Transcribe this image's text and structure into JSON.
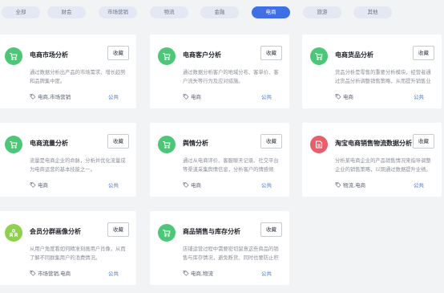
{
  "filters": [
    {
      "label": "全部",
      "active": false
    },
    {
      "label": "财会",
      "active": false
    },
    {
      "label": "市场营销",
      "active": false
    },
    {
      "label": "物流",
      "active": false
    },
    {
      "label": "金融",
      "active": false
    },
    {
      "label": "电商",
      "active": true
    },
    {
      "label": "旅游",
      "active": false
    },
    {
      "label": "其他",
      "active": false
    }
  ],
  "cards": [
    {
      "title": "电商市场分析",
      "fav_label": "收藏",
      "description": "通过数据分析出产品的市场需求、增长趋势和品牌集中度。",
      "tags": "电商,市场营销",
      "scope": "公共",
      "icon": "cart-icon",
      "icon_color": "#4cc777"
    },
    {
      "title": "电商客户分析",
      "fav_label": "收藏",
      "description": "通过数据分析客户的地域分布、客单价、客户流失等行为及应对措施。",
      "tags": "电商",
      "scope": "公共",
      "icon": "cart-icon",
      "icon_color": "#4cc777"
    },
    {
      "title": "电商货品分析",
      "fav_label": "收藏",
      "description": "货品分析是零售的重要分析模块，经营者通过货品分析调整销售策略，从而提升销售业绩。",
      "tags": "电商",
      "scope": "公共",
      "icon": "cart-icon",
      "icon_color": "#4cc777"
    },
    {
      "title": "电商流量分析",
      "fav_label": "收藏",
      "description": "流量是电商企业的命脉，分析并优化流量成为电商运营的基本技能之一。",
      "tags": "电商",
      "scope": "公共",
      "icon": "cart-icon",
      "icon_color": "#4cc777"
    },
    {
      "title": "舆情分析",
      "fav_label": "收藏",
      "description": "通过从电商评价、客服聊天记录、社交平台等渠道采集舆情信息，分析客户的情感倾向。",
      "tags": "电商",
      "scope": "公共",
      "icon": "cart-icon",
      "icon_color": "#4cc777"
    },
    {
      "title": "淘宝电商销售物流数据分析",
      "fav_label": "收藏",
      "description": "分析某电商企业的产品销售情况来指导调整企业的销售策略，以期通过数据提升业绩。",
      "tags": "物流,电商",
      "scope": "公共",
      "icon": "box-icon",
      "icon_color": "#e5606a"
    },
    {
      "title": "会员分群画像分析",
      "fav_label": "收藏",
      "description": "从用户角度看如何精准刻画用户肖像，从而了解不同群集用户的消费情况。",
      "tags": "市场营销,电商",
      "scope": "公共",
      "icon": "people-icon",
      "icon_color": "#8fd14f"
    },
    {
      "title": "商品销售与库存分析",
      "fav_label": "收藏",
      "description": "店铺运营过程中需要密切留意这些商品的销售与库存情况，避免断货、同时也要防止积压。",
      "tags": "电商,物流",
      "scope": "公共",
      "icon": "cart-icon",
      "icon_color": "#4cc777"
    }
  ]
}
